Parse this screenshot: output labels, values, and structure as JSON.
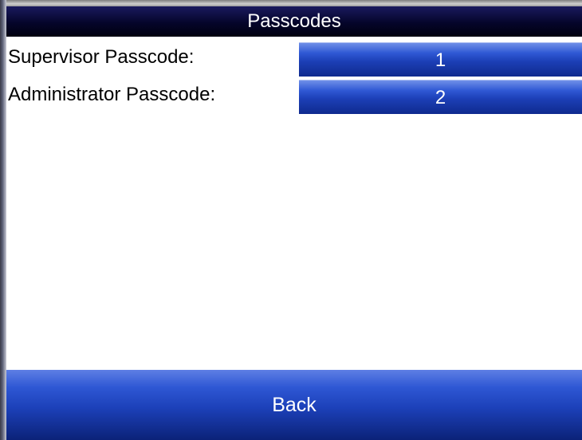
{
  "header": {
    "title": "Passcodes"
  },
  "fields": [
    {
      "label": "Supervisor Passcode:",
      "value": "1"
    },
    {
      "label": "Administrator Passcode:",
      "value": "2"
    }
  ],
  "footer": {
    "back_label": "Back"
  },
  "colors": {
    "title_bar": "#05052a",
    "button_blue": "#1c40b8",
    "text_light": "#ffffff",
    "background": "#ffffff"
  }
}
